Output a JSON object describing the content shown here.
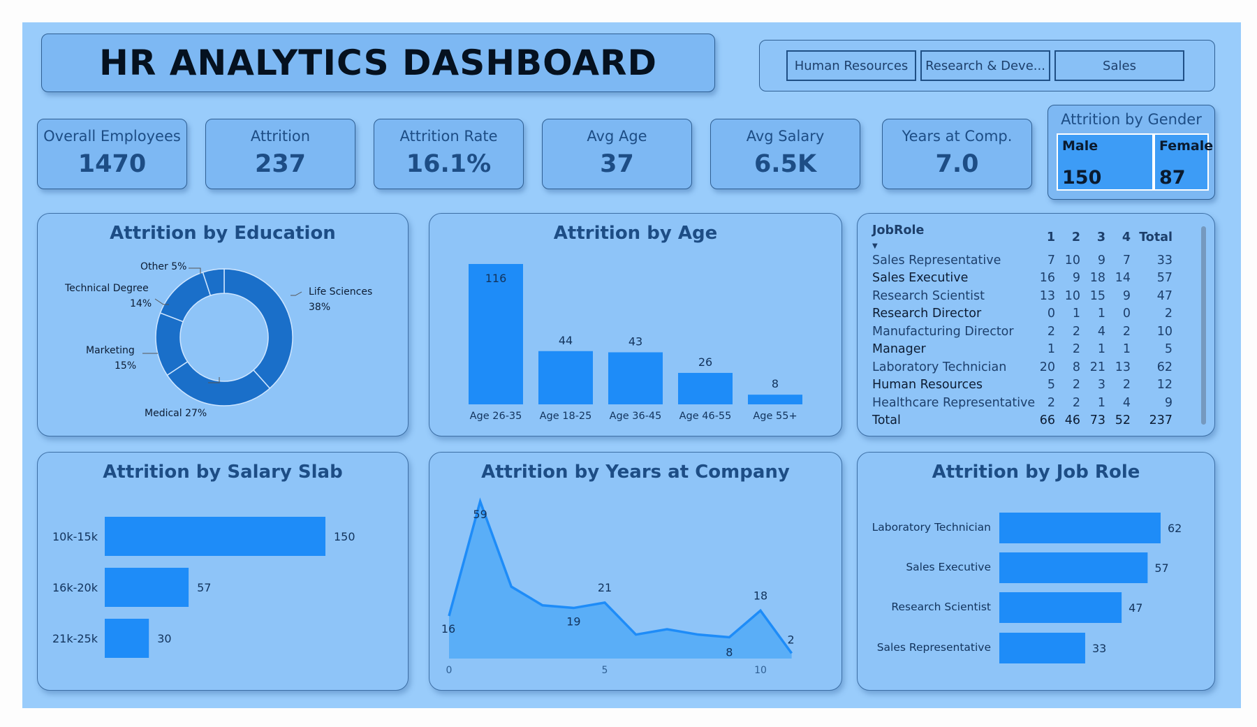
{
  "title": "HR ANALYTICS DASHBOARD",
  "slicer": {
    "items": [
      "Human Resources",
      "Research & Deve...",
      "Sales"
    ]
  },
  "kpis": [
    {
      "label": "Overall Employees",
      "value": "1470"
    },
    {
      "label": "Attrition",
      "value": "237"
    },
    {
      "label": "Attrition Rate",
      "value": "16.1%"
    },
    {
      "label": "Avg Age",
      "value": "37"
    },
    {
      "label": "Avg Salary",
      "value": "6.5K"
    },
    {
      "label": "Years at Comp.",
      "value": "7.0"
    }
  ],
  "gender": {
    "title": "Attrition by Gender",
    "male_label": "Male",
    "male_value": "150",
    "female_label": "Female",
    "female_value": "87"
  },
  "education_chart": {
    "title": "Attrition by Education",
    "labels": [
      {
        "name": "Life Sciences",
        "pct": "38%"
      },
      {
        "name": "Medical",
        "pct": "27%"
      },
      {
        "name": "Marketing",
        "pct": "15%"
      },
      {
        "name": "Technical Degree",
        "pct": "14%"
      },
      {
        "name": "Other",
        "pct": "5%"
      }
    ]
  },
  "age_chart": {
    "title": "Attrition by Age"
  },
  "matrix": {
    "headers": [
      "JobRole",
      "1",
      "2",
      "3",
      "4",
      "Total"
    ],
    "rows": [
      [
        "Sales Representative",
        "7",
        "10",
        "9",
        "7",
        "33"
      ],
      [
        "Sales Executive",
        "16",
        "9",
        "18",
        "14",
        "57"
      ],
      [
        "Research Scientist",
        "13",
        "10",
        "15",
        "9",
        "47"
      ],
      [
        "Research Director",
        "0",
        "1",
        "1",
        "0",
        "2"
      ],
      [
        "Manufacturing Director",
        "2",
        "2",
        "4",
        "2",
        "10"
      ],
      [
        "Manager",
        "1",
        "2",
        "1",
        "1",
        "5"
      ],
      [
        "Laboratory Technician",
        "20",
        "8",
        "21",
        "13",
        "62"
      ],
      [
        "Human Resources",
        "5",
        "2",
        "3",
        "2",
        "12"
      ],
      [
        "Healthcare Representative",
        "2",
        "2",
        "1",
        "4",
        "9"
      ]
    ],
    "total": [
      "Total",
      "66",
      "46",
      "73",
      "52",
      "237"
    ]
  },
  "salary_chart": {
    "title": "Attrition by Salary Slab"
  },
  "years_chart": {
    "title": "Attrition by Years at Company"
  },
  "jobrole_chart": {
    "title": "Attrition by Job Role"
  },
  "colors": {
    "bar": "#1e8cf8",
    "donut": "#1a6fc9",
    "area_fill": "#5aaef7",
    "panel": "#8ec4f8",
    "canvas": "#99ccfb"
  },
  "chart_data": [
    {
      "type": "pie",
      "title": "Attrition by Education",
      "categories": [
        "Life Sciences",
        "Medical",
        "Marketing",
        "Technical Degree",
        "Other"
      ],
      "values": [
        38,
        27,
        15,
        14,
        5
      ]
    },
    {
      "type": "bar",
      "title": "Attrition by Age",
      "categories": [
        "Age 26-35",
        "Age 18-25",
        "Age 36-45",
        "Age 46-55",
        "Age 55+"
      ],
      "values": [
        116,
        44,
        43,
        26,
        8
      ]
    },
    {
      "type": "bar",
      "orientation": "horizontal",
      "title": "Attrition by Salary Slab",
      "categories": [
        "10k-15k",
        "16k-20k",
        "21k-25k"
      ],
      "values": [
        150,
        57,
        30
      ]
    },
    {
      "type": "area",
      "title": "Attrition by Years at Company",
      "x": [
        0,
        1,
        2,
        3,
        4,
        5,
        6,
        7,
        8,
        9,
        10,
        11
      ],
      "values": [
        16,
        59,
        27,
        20,
        19,
        21,
        9,
        11,
        9,
        8,
        18,
        2
      ],
      "xticks": [
        0,
        5,
        10
      ],
      "labels": [
        "16",
        "59",
        "19",
        "21",
        "8",
        "18",
        "2"
      ]
    },
    {
      "type": "bar",
      "orientation": "horizontal",
      "title": "Attrition by Job Role",
      "categories": [
        "Laboratory Technician",
        "Sales Executive",
        "Research Scientist",
        "Sales Representative"
      ],
      "values": [
        62,
        57,
        47,
        33
      ]
    }
  ]
}
